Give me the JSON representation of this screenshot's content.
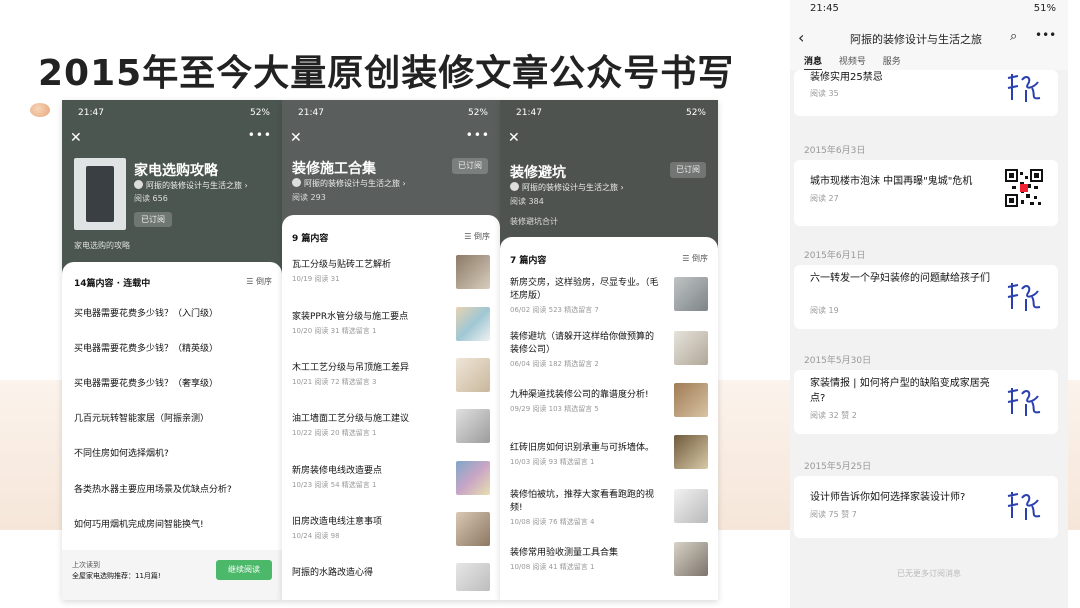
{
  "headline": "2015年至今大量原创装修文章公众号书写",
  "status_time": "21:47",
  "status_battery": "52%",
  "account_name": "阿振的装修设计与生活之旅",
  "phone1": {
    "title": "家电选购攻略",
    "reads": "阅读 656",
    "subscribed": "已订阅",
    "tag": "家电选购的攻略",
    "count": "14篇内容 · 连载中",
    "sort": "倒序",
    "items": [
      "买电器需要花费多少钱？（入门级）",
      "买电器需要花费多少钱？（精英级）",
      "买电器需要花费多少钱？（奢享级）",
      "几百元玩转智能家居（阿振亲测）",
      "不同住房如何选择烟机?",
      "各类热水器主要应用场景及优缺点分析?",
      "如何巧用烟机完成房间智能换气!"
    ],
    "last_read_label": "上次读到",
    "last_read_title": "全屋家电选购推荐：11月篇!",
    "continue": "继续阅读"
  },
  "phone2": {
    "title": "装修施工合集",
    "reads": "阅读 293",
    "subscribed": "已订阅",
    "count": "9 篇内容",
    "sort": "倒序",
    "articles": [
      {
        "title": "瓦工分级与贴砖工艺解析",
        "meta": "10/19  阅读 31"
      },
      {
        "title": "家装PPR水管分级与施工要点",
        "meta": "10/20  阅读 31  精选留言 1"
      },
      {
        "title": "木工工艺分级与吊顶施工差异",
        "meta": "10/21  阅读 72  精选留言 3"
      },
      {
        "title": "油工墙面工艺分级与施工建议",
        "meta": "10/22  阅读 20  精选留言 1"
      },
      {
        "title": "新房装修电线改造要点",
        "meta": "10/23  阅读 54  精选留言 1"
      },
      {
        "title": "旧房改造电线注意事项",
        "meta": "10/24  阅读 98"
      },
      {
        "title": "阿振的水路改造心得",
        "meta": ""
      }
    ]
  },
  "phone3": {
    "title": "装修避坑",
    "reads": "阅读 384",
    "subscribed": "已订阅",
    "tag": "装修避坑合计",
    "count": "7 篇内容",
    "sort": "倒序",
    "articles": [
      {
        "title": "新房交房，这样验房，尽显专业。（毛坯房版）",
        "meta": "06/02  阅读 523  精选留言 7"
      },
      {
        "title": "装修避坑（请躲开这样给你做预算的装修公司）",
        "meta": "06/04  阅读 182  精选留言 2"
      },
      {
        "title": "九种渠道找装修公司的靠谱度分析!",
        "meta": "09/29  阅读 103  精选留言 5"
      },
      {
        "title": "红砖旧房如何识别承重与可拆墙体。",
        "meta": "10/03  阅读 93  精选留言 1"
      },
      {
        "title": "装修怕被坑，推荐大家看看跑跑的视频!",
        "meta": "10/08  阅读 76  精选留言 4"
      },
      {
        "title": "装修常用验收测量工具合集",
        "meta": "10/08  阅读 41  精选留言 1"
      }
    ]
  },
  "right": {
    "time": "21:45",
    "battery": "51%",
    "nav_title": "阿振的装修设计与生活之旅",
    "tabs": [
      "消息",
      "视频号",
      "服务"
    ],
    "messages": [
      {
        "date": "",
        "title": "装修实用25禁忌",
        "meta": "阅读 35",
        "thumb": "signature"
      },
      {
        "date": "2015年6月3日",
        "title": "城市现楼市泡沫 中国再曝\"鬼城\"危机",
        "meta": "阅读 27",
        "thumb": "qr"
      },
      {
        "date": "2015年6月1日",
        "title": "六一转发一个孕妇装修的问题献给孩子们",
        "meta": "阅读 19",
        "thumb": "signature"
      },
      {
        "date": "2015年5月30日",
        "title": "家装情报 | 如何将户型的缺陷变成家居亮点?",
        "meta": "阅读 32  赞 2",
        "thumb": "signature"
      },
      {
        "date": "2015年5月25日",
        "title": "设计师告诉你如何选择家装设计师?",
        "meta": "阅读 75  赞 7",
        "thumb": "signature"
      }
    ],
    "end_text": "已无更多订阅消息"
  }
}
